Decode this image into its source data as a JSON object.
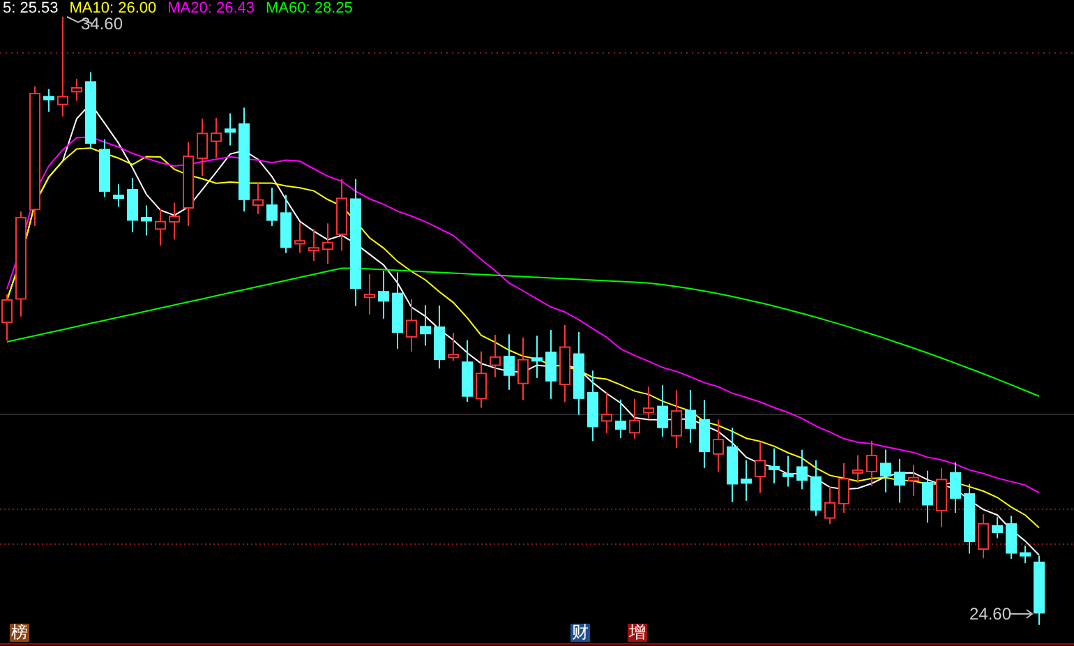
{
  "legend": [
    {
      "label": "5: 25.53",
      "color": "#ffffff"
    },
    {
      "label": "MA10: 26.00",
      "color": "#ffff00"
    },
    {
      "label": "MA20: 26.43",
      "color": "#ff00ff"
    },
    {
      "label": "MA60: 28.25",
      "color": "#00ff00"
    }
  ],
  "price_labels": {
    "high": "34.60",
    "low": "24.60"
  },
  "badges": [
    {
      "label": "榜",
      "color": "#8b4513"
    },
    {
      "label": "财",
      "color": "#1f4e8c"
    },
    {
      "label": "增",
      "color": "#a01010"
    }
  ]
}
